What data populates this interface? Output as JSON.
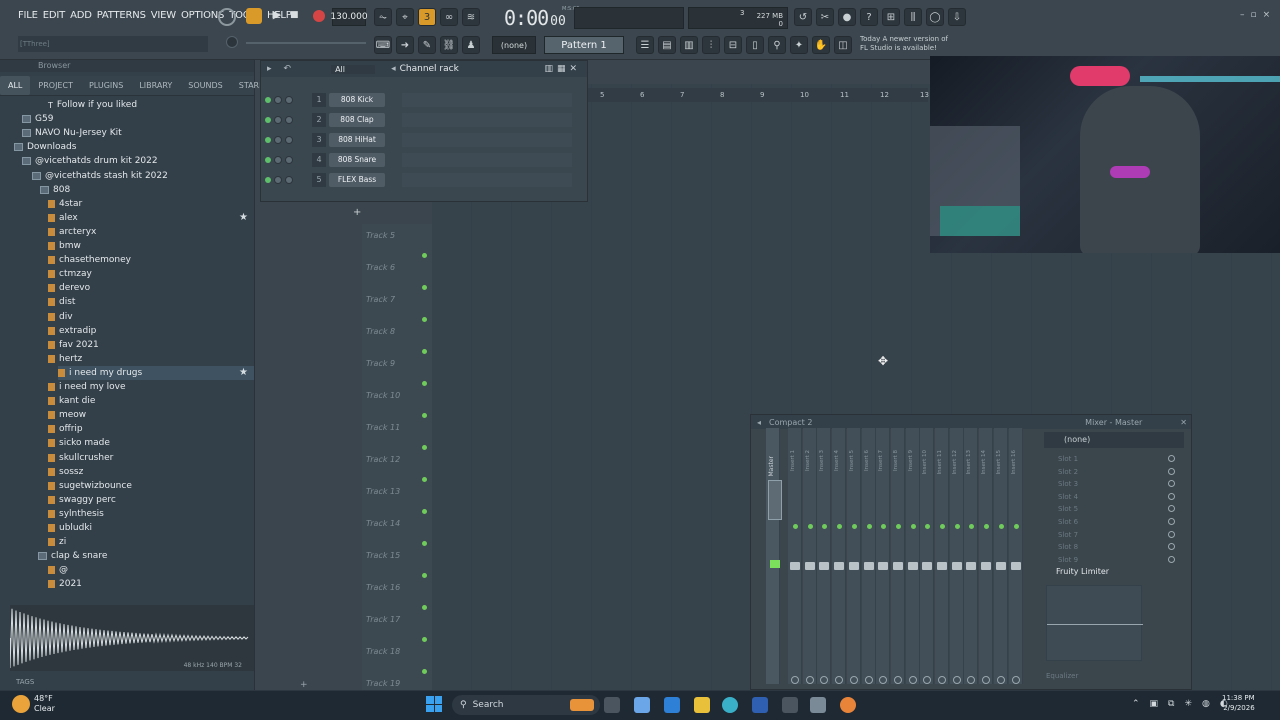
{
  "menu": [
    "FILE",
    "EDIT",
    "ADD",
    "PATTERNS",
    "VIEW",
    "OPTIONS",
    "TOOLS",
    "HELP"
  ],
  "transport": {
    "tempo": "130.000",
    "time": "0:00",
    "time_frac": "00",
    "time_mode": "M:S:CS",
    "pattern": "Pattern 1",
    "snap": "(none)",
    "cpu": "3",
    "mem": "227 MB",
    "poly": "0"
  },
  "hint": {
    "line1": "Today  A newer version of",
    "line2": "FL Studio is available!"
  },
  "title_hint": "[TThree]",
  "browser": {
    "title": "Browser",
    "tabs": [
      "ALL",
      "PROJECT",
      "PLUGINS",
      "LIBRARY",
      "SOUNDS",
      "STARRED"
    ],
    "items": [
      {
        "label": "Follow if you liked",
        "type": "text"
      },
      {
        "label": "G59",
        "type": "folder"
      },
      {
        "label": "NAVO Nu-Jersey Kit",
        "type": "folder"
      },
      {
        "label": "Downloads",
        "type": "folder"
      },
      {
        "label": "@vicethatds drum kit 2022",
        "type": "folder"
      },
      {
        "label": "@vicethatds stash kit 2022",
        "type": "folder"
      },
      {
        "label": "808",
        "type": "folder"
      },
      {
        "label": "4star",
        "type": "file"
      },
      {
        "label": "alex",
        "type": "file",
        "starred": true
      },
      {
        "label": "arcteryx",
        "type": "file"
      },
      {
        "label": "bmw",
        "type": "file"
      },
      {
        "label": "chasethemoney",
        "type": "file"
      },
      {
        "label": "ctmzay",
        "type": "file"
      },
      {
        "label": "derevo",
        "type": "file"
      },
      {
        "label": "dist",
        "type": "file"
      },
      {
        "label": "div",
        "type": "file"
      },
      {
        "label": "extradip",
        "type": "file"
      },
      {
        "label": "fav 2021",
        "type": "file"
      },
      {
        "label": "hertz",
        "type": "file"
      },
      {
        "label": "i need my drugs",
        "type": "file",
        "starred": true,
        "selected": true
      },
      {
        "label": "i need my love",
        "type": "file"
      },
      {
        "label": "kant die",
        "type": "file"
      },
      {
        "label": "meow",
        "type": "file"
      },
      {
        "label": "offrip",
        "type": "file"
      },
      {
        "label": "sicko made",
        "type": "file"
      },
      {
        "label": "skullcrusher",
        "type": "file"
      },
      {
        "label": "sossz",
        "type": "file"
      },
      {
        "label": "sugetwizbounce",
        "type": "file"
      },
      {
        "label": "swaggy perc",
        "type": "file"
      },
      {
        "label": "sylnthesis",
        "type": "file"
      },
      {
        "label": "ubludki",
        "type": "file"
      },
      {
        "label": "zi",
        "type": "file"
      },
      {
        "label": "clap & snare",
        "type": "folder"
      },
      {
        "label": "@",
        "type": "file"
      },
      {
        "label": "2021",
        "type": "file"
      }
    ],
    "wave_info": "48 kHz 140 BPM 32",
    "tags_label": "TAGS"
  },
  "rack": {
    "title": "Channel rack",
    "filter": "All",
    "channels": [
      {
        "num": "1",
        "name": "808 Kick"
      },
      {
        "num": "2",
        "name": "808 Clap"
      },
      {
        "num": "3",
        "name": "808 HiHat"
      },
      {
        "num": "4",
        "name": "808 Snare"
      },
      {
        "num": "5",
        "name": "FLEX Bass"
      }
    ],
    "add": "+"
  },
  "playlist": {
    "ruler": [
      "5",
      "6",
      "7",
      "8",
      "9",
      "10",
      "11",
      "12",
      "13"
    ],
    "tracks": [
      "Track 5",
      "Track 6",
      "Track 7",
      "Track 8",
      "Track 9",
      "Track 10",
      "Track 11",
      "Track 12",
      "Track 13",
      "Track 14",
      "Track 15",
      "Track 16",
      "Track 17",
      "Track 18",
      "Track 19"
    ]
  },
  "mixer": {
    "title": "Compact 2",
    "master_title": "Mixer - Master",
    "preset": "(none)",
    "master_label": "Master",
    "inserts": [
      "Insert 1",
      "Insert 2",
      "Insert 3",
      "Insert 4",
      "Insert 5",
      "Insert 6",
      "Insert 7",
      "Insert 8",
      "Insert 9",
      "Insert 10",
      "Insert 11",
      "Insert 12",
      "Insert 13",
      "Insert 14",
      "Insert 15",
      "Insert 16"
    ],
    "slots": [
      "Slot 1",
      "Slot 2",
      "Slot 3",
      "Slot 4",
      "Slot 5",
      "Slot 6",
      "Slot 7",
      "Slot 8",
      "Slot 9"
    ],
    "effect": "Fruity Limiter",
    "eq_label": "Equalizer"
  },
  "taskbar": {
    "weather_temp": "48°F",
    "weather_desc": "Clear",
    "search": "Search",
    "clock": "11:38 PM",
    "date": "2/9/2026"
  }
}
